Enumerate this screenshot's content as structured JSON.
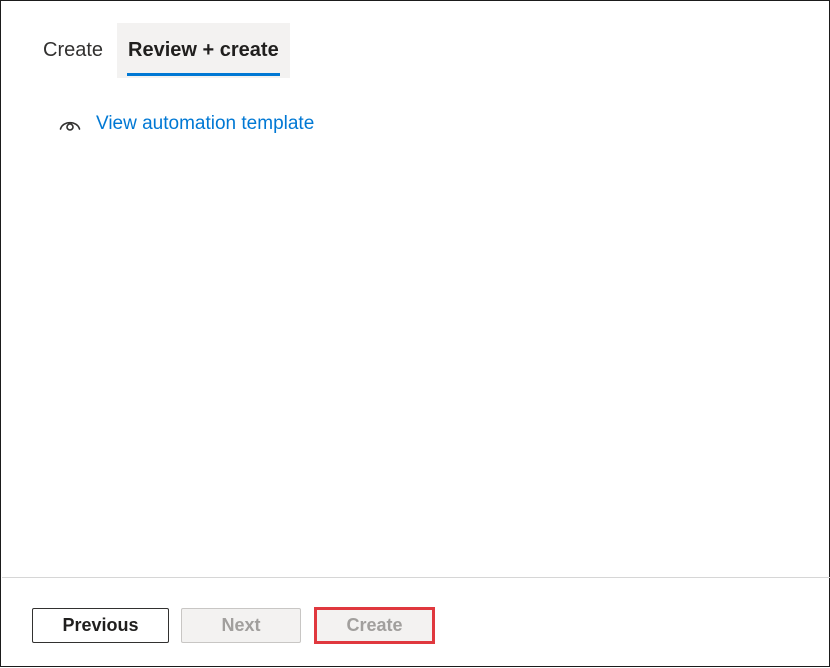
{
  "tabs": [
    {
      "label": "Create",
      "active": false
    },
    {
      "label": "Review + create",
      "active": true
    }
  ],
  "template_link": {
    "label": "View automation template",
    "icon": "eye-icon",
    "color": "#0078d4"
  },
  "footer": {
    "previous_label": "Previous",
    "next_label": "Next",
    "create_label": "Create",
    "highlight_color": "#e0383e"
  }
}
